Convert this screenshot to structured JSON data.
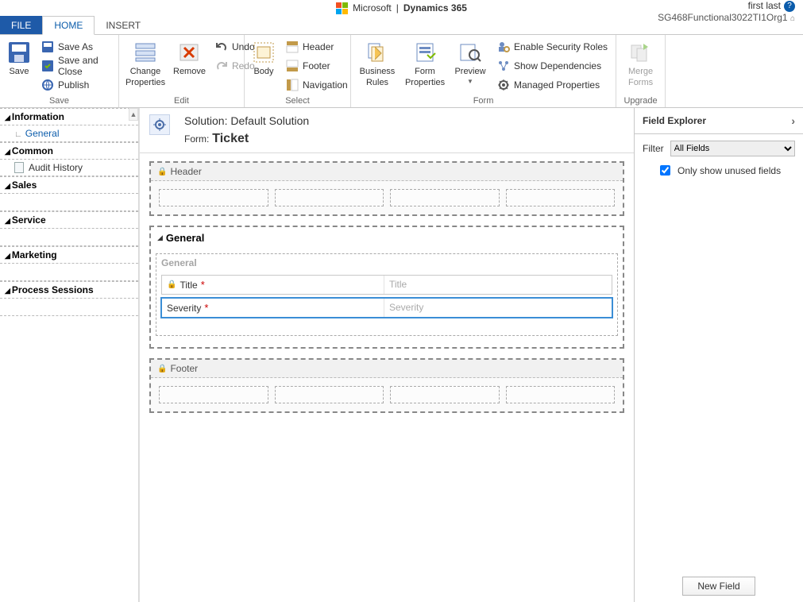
{
  "appbar": {
    "brand": "Microsoft",
    "product": "Dynamics 365",
    "user": "first last",
    "org": "SG468Functional3022TI1Org1"
  },
  "tabs": {
    "file": "FILE",
    "home": "HOME",
    "insert": "INSERT"
  },
  "ribbon": {
    "save": {
      "save": "Save",
      "saveAs": "Save As",
      "saveClose": "Save and Close",
      "publish": "Publish",
      "label": "Save"
    },
    "edit": {
      "change1": "Change",
      "change2": "Properties",
      "remove": "Remove",
      "undo": "Undo",
      "redo": "Redo",
      "label": "Edit"
    },
    "select": {
      "body": "Body",
      "header": "Header",
      "footer": "Footer",
      "nav": "Navigation",
      "label": "Select"
    },
    "form": {
      "br1": "Business",
      "br2": "Rules",
      "fp1": "Form",
      "fp2": "Properties",
      "preview": "Preview",
      "sec": "Enable Security Roles",
      "dep": "Show Dependencies",
      "mp": "Managed Properties",
      "label": "Form"
    },
    "upgrade": {
      "mf1": "Merge",
      "mf2": "Forms",
      "label": "Upgrade"
    }
  },
  "leftnav": {
    "info": "Information",
    "general": "General",
    "common": "Common",
    "audit": "Audit History",
    "sales": "Sales",
    "service": "Service",
    "marketing": "Marketing",
    "procs": "Process Sessions"
  },
  "canvas": {
    "solution": "Solution: Default Solution",
    "formLabel": "Form:",
    "formName": "Ticket",
    "headerSec": "Header",
    "generalSec": "General",
    "generalSub": "General",
    "titleLabel": "Title",
    "titlePh": "Title",
    "sevLabel": "Severity",
    "sevPh": "Severity",
    "footerSec": "Footer"
  },
  "right": {
    "title": "Field Explorer",
    "filterLabel": "Filter",
    "filterValue": "All Fields",
    "onlyUnused": "Only show unused fields",
    "newField": "New Field"
  }
}
